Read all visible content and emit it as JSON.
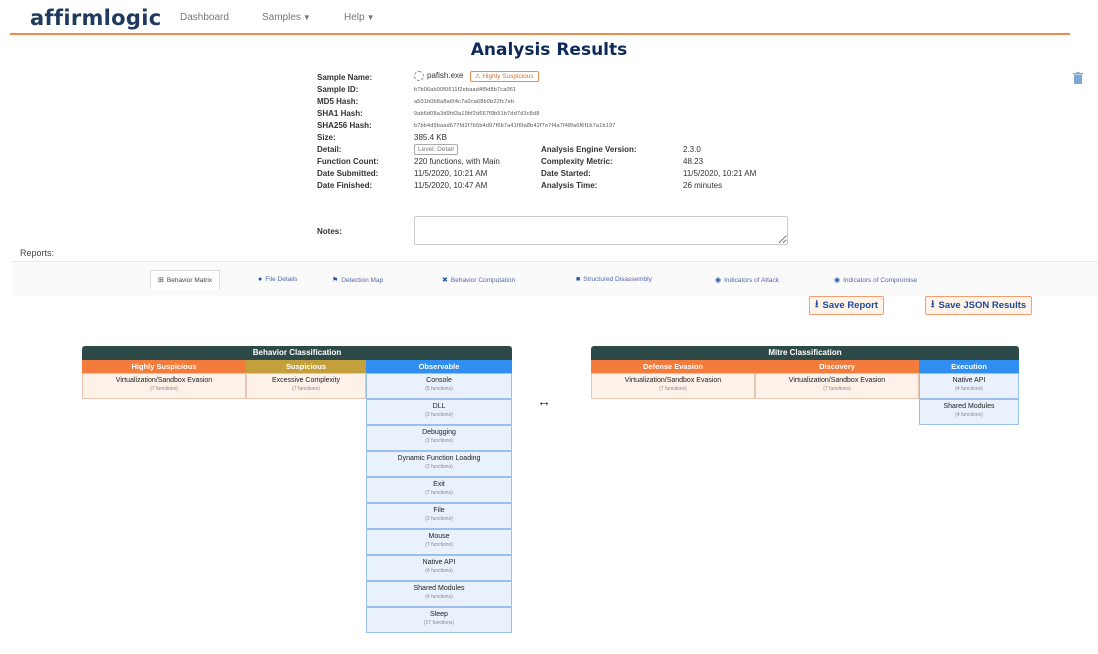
{
  "nav": {
    "logo": "affirmlogic",
    "dashboard": "Dashboard",
    "samples": "Samples",
    "help": "Help"
  },
  "title": "Analysis Results",
  "sample": {
    "name_label": "Sample Name:",
    "name_value": "pafish.exe",
    "badge": "Highly Suspicious",
    "id_label": "Sample ID:",
    "id_value": "b7b06ab00f0611f2ebaad4f9d8b7ca061",
    "md5_label": "MD5 Hash:",
    "md5_value": "a501b0b8a8a6f4c7a0ca68b0b22fc7eb",
    "sha1_label": "SHA1 Hash:",
    "sha1_value": "9ab6d08a3d9fd3a19bf2d667f9b51b7dd7d3c8d8",
    "sha256_label": "SHA256 Hash:",
    "sha256_value": "b7bb4d9baad677fd2f7b5b4d97f6b7a41f6fa8b42f7e7f4a7f48fa6f6f1b7a1b197",
    "size_label": "Size:",
    "size_value": "385.4 KB",
    "detail_label": "Detail:",
    "detail_value": "Level: Detail",
    "engine_label": "Analysis Engine Version:",
    "engine_value": "2.3.0",
    "fcount_label": "Function Count:",
    "fcount_value": "220 functions, with Main",
    "complexity_label": "Complexity Metric:",
    "complexity_value": "48.23",
    "submitted_label": "Date Submitted:",
    "submitted_value": "11/5/2020, 10:21 AM",
    "started_label": "Date Started:",
    "started_value": "11/5/2020, 10:21 AM",
    "finished_label": "Date Finished:",
    "finished_value": "11/5/2020, 10:47 AM",
    "atime_label": "Analysis Time:",
    "atime_value": "26 minutes",
    "notes_label": "Notes:"
  },
  "reports_label": "Reports:",
  "tabs": [
    {
      "icon": "⊞",
      "label": "Behavior Matrix"
    },
    {
      "icon": "●",
      "label": "File Details"
    },
    {
      "icon": "⚑",
      "label": "Detection Map"
    },
    {
      "icon": "✖",
      "label": "Behavior Computation"
    },
    {
      "icon": "■",
      "label": "Structured Disassembly"
    },
    {
      "icon": "◉",
      "label": "Indicators of Attack"
    },
    {
      "icon": "◉",
      "label": "Indicators of Compromise"
    }
  ],
  "buttons": {
    "save_report": "Save Report",
    "save_json": "Save JSON Results"
  },
  "colors": {
    "highly_suspicious": "#f37b3c",
    "suspicious": "#c4a03c",
    "observable": "#2f8ef0",
    "header_dark": "#2e4a48"
  },
  "behavior": {
    "title": "Behavior Classification",
    "highly_suspicious": {
      "header": "Highly Suspicious",
      "items": [
        {
          "name": "Virtualization/Sandbox Evasion",
          "count": "(7 functions)"
        }
      ]
    },
    "suspicious": {
      "header": "Suspicious",
      "items": [
        {
          "name": "Excessive Complexity",
          "count": "(7 functions)"
        }
      ]
    },
    "observable": {
      "header": "Observable",
      "items": [
        {
          "name": "Console",
          "count": "(5 functions)"
        },
        {
          "name": "DLL",
          "count": "(2 functions)"
        },
        {
          "name": "Debugging",
          "count": "(2 functions)"
        },
        {
          "name": "Dynamic Function Loading",
          "count": "(2 functions)"
        },
        {
          "name": "Exit",
          "count": "(7 functions)"
        },
        {
          "name": "File",
          "count": "(2 functions)"
        },
        {
          "name": "Mouse",
          "count": "(7 functions)"
        },
        {
          "name": "Native API",
          "count": "(4 functions)"
        },
        {
          "name": "Shared Modules",
          "count": "(4 functions)"
        },
        {
          "name": "Sleep",
          "count": "(17 functions)"
        }
      ]
    }
  },
  "mitre": {
    "title": "Mitre Classification",
    "defense_evasion": {
      "header": "Defense Evasion",
      "items": [
        {
          "name": "Virtualization/Sandbox Evasion",
          "count": "(7 functions)"
        }
      ]
    },
    "discovery": {
      "header": "Discovery",
      "items": [
        {
          "name": "Virtualization/Sandbox Evasion",
          "count": "(7 functions)"
        }
      ]
    },
    "execution": {
      "header": "Execution",
      "items": [
        {
          "name": "Native API",
          "count": "(4 functions)"
        },
        {
          "name": "Shared Modules",
          "count": "(4 functions)"
        }
      ]
    }
  },
  "arrow": "↔"
}
